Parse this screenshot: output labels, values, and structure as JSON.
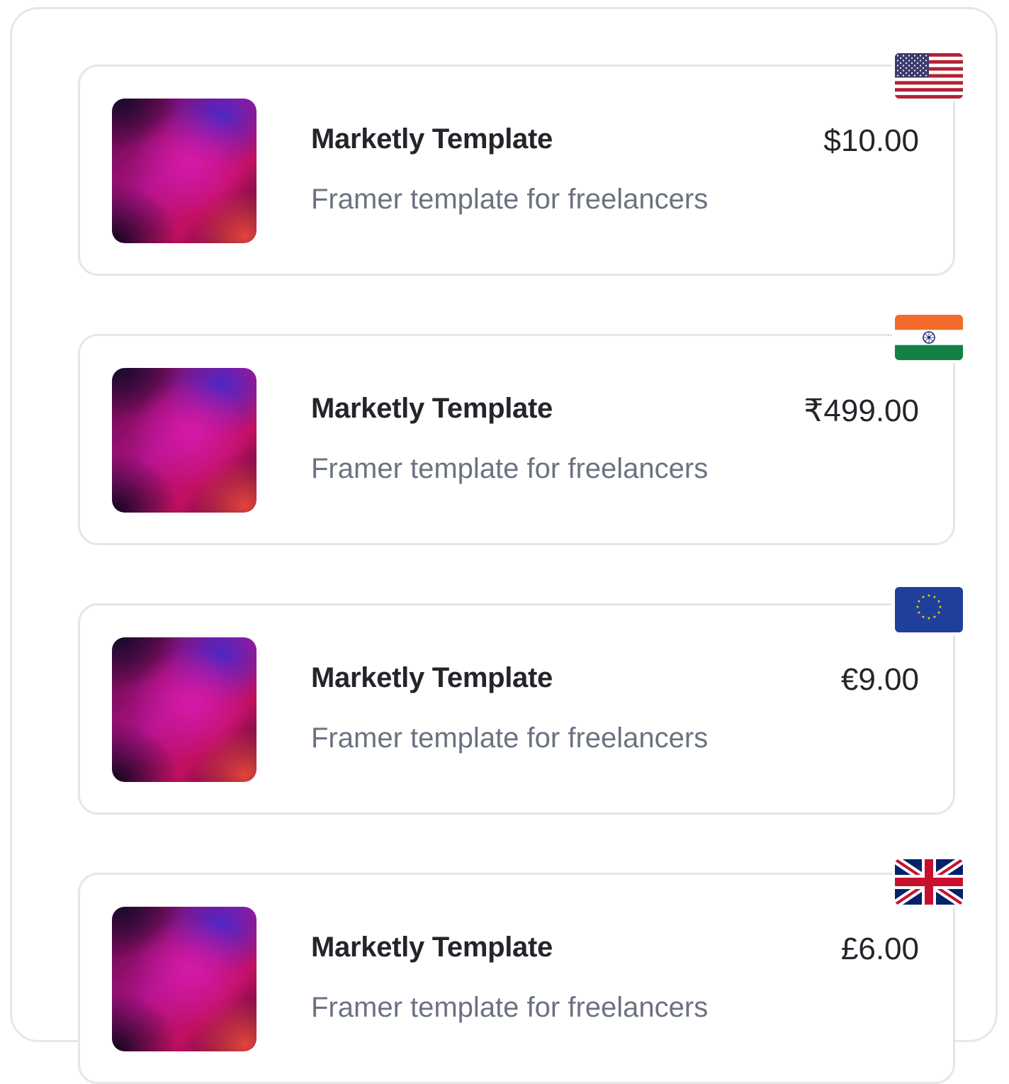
{
  "products": [
    {
      "title": "Marketly Template",
      "subtitle": "Framer template for freelancers",
      "price": "$10.00",
      "flag_icon": "us-flag-icon"
    },
    {
      "title": "Marketly Template",
      "subtitle": "Framer template for freelancers",
      "price": "₹499.00",
      "flag_icon": "india-flag-icon"
    },
    {
      "title": "Marketly Template",
      "subtitle": "Framer template for freelancers",
      "price": "€9.00",
      "flag_icon": "eu-flag-icon"
    },
    {
      "title": "Marketly Template",
      "subtitle": "Framer template for freelancers",
      "price": "£6.00",
      "flag_icon": "uk-flag-icon"
    }
  ],
  "colors": {
    "title": "#24252b",
    "subtitle": "#6b7280",
    "card_border": "#e5e6e9",
    "us_blue": "#3c3b6e",
    "us_red": "#b22234",
    "india_saffron": "#f26b2a",
    "india_green": "#138045",
    "india_chakra": "#1a2a7a",
    "eu_blue": "#1f3f9c",
    "eu_star": "#ffd700",
    "uk_blue": "#012169",
    "uk_red": "#c8102e"
  }
}
